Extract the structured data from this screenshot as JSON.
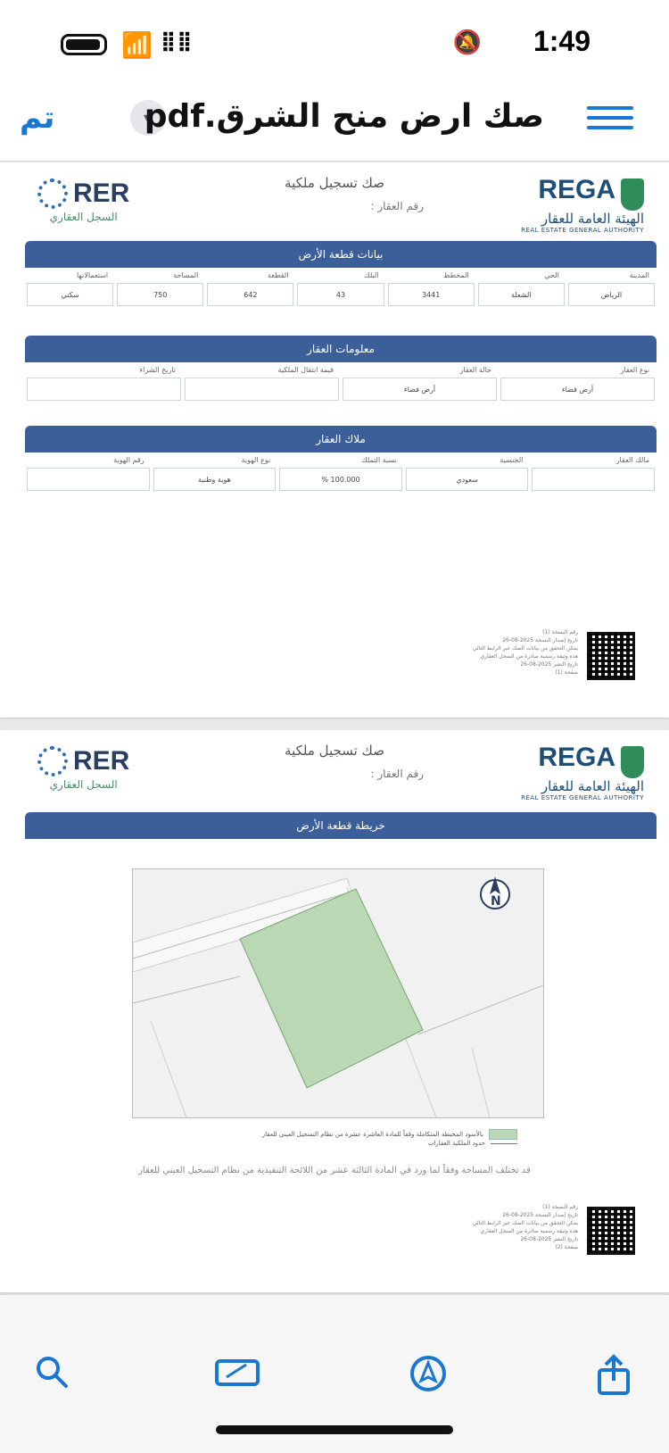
{
  "status_bar": {
    "time": "1:49"
  },
  "nav": {
    "done_label": "تم",
    "title": "صك ارض منح الشرق.pdf"
  },
  "doc": {
    "title": "صك تسجيل ملكية",
    "ref_label": "رقم العقار :",
    "rer": {
      "name": "RER",
      "subtitle": "السجل العقاري"
    },
    "rega": {
      "name": "REGA",
      "arabic": "الهيئة العامة للعقار",
      "english": "REAL ESTATE GENERAL AUTHORITY"
    }
  },
  "page1": {
    "section1": {
      "title": "بيانات قطعة الأرض",
      "headers": [
        "المدينة",
        "الحي",
        "المخطط",
        "البلك",
        "القطعة",
        "المساحة",
        "استعمالاتها"
      ],
      "values": [
        "الرياض",
        "الشعلة",
        "3441",
        "43",
        "642",
        "750",
        "سكني"
      ]
    },
    "section2": {
      "title": "معلومات العقار",
      "headers": [
        "نوع العقار",
        "حالة العقار",
        "قيمة انتقال الملكية",
        "تاريخ الشراء"
      ],
      "values": [
        "أرض فضاء",
        "أرض فضاء",
        "",
        ""
      ]
    },
    "section3": {
      "title": "ملاك العقار",
      "headers": [
        "مالك العقار",
        "الجنسية",
        "نسبة التملك",
        "نوع الهوية",
        "رقم الهوية"
      ],
      "values": [
        "",
        "سعودي",
        "100.000 %",
        "هوية وطنية",
        ""
      ]
    },
    "footer": {
      "lines": [
        "رقم النسخة (1)",
        "تاريخ إصدار النسخة 2025-08-26",
        "يمكن التحقق من بيانات الصك عبر الرابط التالي",
        "هذه وثيقة رسمية صادرة من السجل العقاري",
        "تاريخ النشر 2025-08-26",
        "صفحة (1)"
      ]
    }
  },
  "page2": {
    "section_title": "خريطة قطعة الأرض",
    "legend": [
      "بالأسود المحيطة المتكاملة وفقاً للمادة العاشرة عشرة من نظام التسجيل العيني للعقار",
      "حدود الملكية العقارات"
    ],
    "note": "قد تختلف المساحة وفقاً لما ورد في المادة الثالثة عشر من اللائحة التنفيذية من نظام التسجيل العيني للعقار",
    "footer": {
      "lines": [
        "رقم النسخة (1)",
        "تاريخ إصدار النسخة 2025-08-26",
        "يمكن التحقق من بيانات الصك عبر الرابط التالي",
        "هذه وثيقة رسمية صادرة من السجل العقاري",
        "تاريخ النشر 2025-08-26",
        "صفحة (2)"
      ]
    }
  },
  "colors": {
    "accent": "#1976d2",
    "section_bar": "#3c5f99",
    "parcel": "#b9d8b3"
  }
}
